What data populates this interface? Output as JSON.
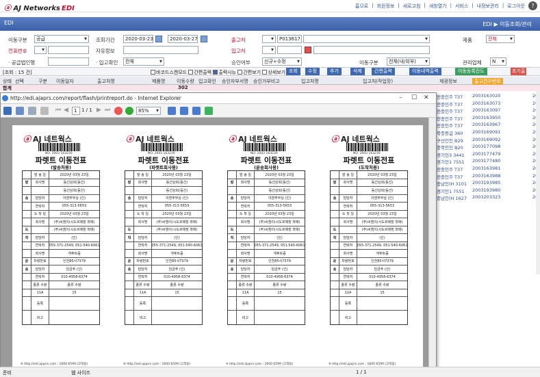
{
  "header": {
    "brand": "AJ Networks",
    "brand_edi": "EDI",
    "nav": [
      "홈으로",
      "회원정보",
      "새로고침",
      "새창열기",
      "서비스",
      "내정보관리",
      "로그아웃"
    ]
  },
  "bluebar": {
    "home_label": "EDI",
    "breadcrumb": "EDI ▶ 이동조회/관리"
  },
  "filters": {
    "move_type_label": "이동구분",
    "move_type_value": "공급",
    "period_label": "조회기간",
    "date_from": "2020-03-23",
    "date_to": "2020-03-27",
    "supplier_label": "출고처",
    "supplier_code": "P013617",
    "product_label": "제품",
    "product_value": "전체",
    "slip_no_label": "전표번호",
    "drop_label": "자유정보",
    "receiver_label": "입고처",
    "final_label": "최종확인",
    "final_value": "전체",
    "approve_label": "승인여부",
    "approve_value": "신규+수정",
    "move_div_label": "이동구분",
    "move_div_value": "전체(내/외부)",
    "manage_label": "관리업체",
    "manage_value": "N"
  },
  "grid": {
    "count_label": "[조회 : 15 건]",
    "options": [
      "바코드스캔모드",
      "간편출력",
      "출력시뉴",
      "간편보기",
      "상세보기"
    ],
    "search_btn": "조회",
    "buttons": [
      "수정",
      "추가",
      "삭제",
      "간편출력",
      "이동내역출력",
      "이동등록진도",
      "조기출"
    ],
    "headers": [
      "상태",
      "선택",
      "구분",
      "이동일자",
      "출고처명",
      "제품명",
      "이동수량",
      "입고확인",
      "승인자부서명",
      "승인거부비고",
      "입고처명",
      "입고처(작업장)",
      "제광정보",
      "출고건수번호"
    ],
    "sum_label": "합계",
    "sum_value": "302"
  },
  "right_rows": [
    {
      "a": "전충인주 T37",
      "b": "2003163020",
      "c": "20"
    },
    {
      "a": "전충인주 T37",
      "b": "2003163073",
      "c": "20"
    },
    {
      "a": "전충인주 T37",
      "b": "2003163097",
      "c": "20"
    },
    {
      "a": "전충인주 T37",
      "b": "2003163950",
      "c": "20"
    },
    {
      "a": "전충인주 T37",
      "b": "2003163967",
      "c": "20"
    },
    {
      "a": "북충등급 360",
      "b": "2003169091",
      "c": "20"
    },
    {
      "a": "구산인인 B29",
      "b": "2003169092",
      "c": "20"
    },
    {
      "a": "충북인인 B20",
      "b": "2003177098",
      "c": "20"
    },
    {
      "a": "경기인3 3441",
      "b": "2003177479",
      "c": "20"
    },
    {
      "a": "경기인1 7551",
      "b": "2003177480",
      "c": "20"
    },
    {
      "a": "전충인주 T37",
      "b": "2003163981",
      "c": "20"
    },
    {
      "a": "전충인주 T37",
      "b": "2003163988",
      "c": "20"
    },
    {
      "a": "충남인(H 3101",
      "b": "2003193985",
      "c": "20"
    },
    {
      "a": "경기인1 7551",
      "b": "2003193980",
      "c": "20"
    },
    {
      "a": "충남인(H 1627",
      "b": "2003203323",
      "c": "20"
    }
  ],
  "popup": {
    "url": "http://edi.ajaprs.com/report/flash/printreport.do - Internet Explorer",
    "page_indicator": "1 / 1",
    "zoom": "85%"
  },
  "slip": {
    "brand": "AJ 네트웍스",
    "barcode_no": "NO. 2003 163230",
    "title": "파렛트 이동전표",
    "subtypes": [
      "(발송처용)",
      "(파렛트회사용)",
      "(운송회사용)",
      "(도착처용)"
    ],
    "rows": [
      {
        "c1": "",
        "c2": "발 송 일",
        "c3": "2020년 03월 23일"
      },
      {
        "c1": "발",
        "c2": "회사명",
        "c3": "동선상회(동선)"
      },
      {
        "c1": "",
        "c2": "",
        "c3": "동선상회(동선)"
      },
      {
        "c1": "송",
        "c2": "담당자",
        "c3": "이엔주부상   (인)"
      },
      {
        "c1": "",
        "c2": "연락처",
        "c3": "055-313-5653"
      },
      {
        "c1": "",
        "c2": "도 착 일",
        "c3": "2020년 03월 23일"
      },
      {
        "c1": "",
        "c2": "회사명",
        "c3": "(주)씨엠이(시도르매장 좌매)"
      },
      {
        "c1": "도",
        "c2": "",
        "c3": "(주)씨엠이(시도르매장 좌매)"
      },
      {
        "c1": "착",
        "c2": "담당자",
        "c3": "(인)"
      },
      {
        "c1": "",
        "c2": "연락처",
        "c3": "055-371-2549, 051-540-6061"
      },
      {
        "c1": "",
        "c2": "회사명",
        "c3": "개후트즘"
      },
      {
        "c1": "운",
        "c2": "차량번호",
        "c3": "인천85사7379"
      },
      {
        "c1": "송",
        "c2": "담당자",
        "c3": "임금주   (인)"
      },
      {
        "c1": "",
        "c2": "연락처",
        "c3": "010-4958-6374"
      },
      {
        "c1": "",
        "c2": "종류 수량",
        "c3": "종류 수량"
      },
      {
        "c1": "",
        "c2": "11A",
        "c3": "15"
      }
    ],
    "remark_label": "비고",
    "sign_label": "등록",
    "footer": "※ http://edi.ajaprs.com : 1600 6599 (고객용)"
  },
  "status": {
    "left": "준비",
    "mid": "웹 사이즈",
    "page": "1 / 1"
  }
}
